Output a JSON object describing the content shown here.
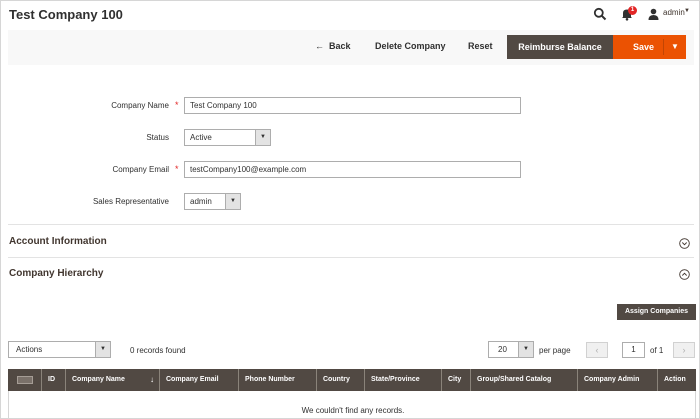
{
  "header": {
    "title": "Test Company 100",
    "notification_count": "1",
    "user_name": "admin"
  },
  "toolbar": {
    "back_label": "Back",
    "delete_label": "Delete Company",
    "reset_label": "Reset",
    "reimburse_label": "Reimburse Balance",
    "save_label": "Save"
  },
  "form": {
    "company_name_label": "Company Name",
    "company_name_value": "Test Company 100",
    "status_label": "Status",
    "status_value": "Active",
    "email_label": "Company Email",
    "email_value": "testCompany100@example.com",
    "sales_rep_label": "Sales Representative",
    "sales_rep_value": "admin"
  },
  "sections": {
    "account_info": "Account Information",
    "hierarchy": "Company Hierarchy"
  },
  "grid": {
    "assign_label": "Assign Companies",
    "actions_value": "Actions",
    "records_found": "0 records found",
    "per_page_value": "20",
    "per_page_label": "per page",
    "page_value": "1",
    "page_of": "of 1",
    "columns": [
      "ID",
      "Company Name",
      "Company Email",
      "Phone Number",
      "Country",
      "State/Province",
      "City",
      "Group/Shared Catalog",
      "Company Admin",
      "Action"
    ],
    "empty_message": "We couldn't find any records."
  },
  "colors": {
    "accent": "#eb5202",
    "dark_button": "#514943",
    "required": "#e22626"
  }
}
